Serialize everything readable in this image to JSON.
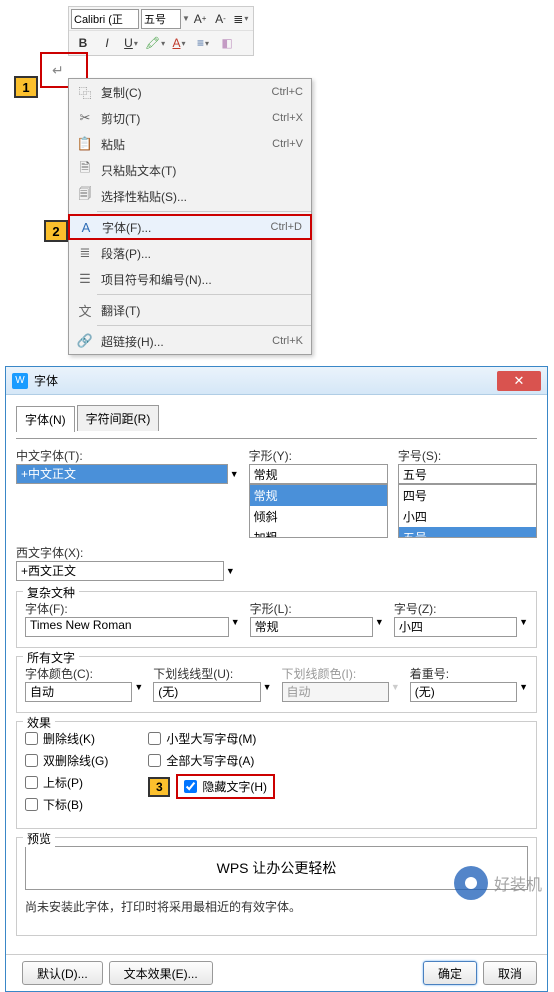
{
  "toolbar": {
    "font_name": "Calibri (正",
    "font_size": "五号"
  },
  "markers": {
    "m1": "1",
    "m2": "2",
    "m3": "3"
  },
  "ctx": {
    "copy": {
      "label": "复制(C)",
      "shortcut": "Ctrl+C"
    },
    "cut": {
      "label": "剪切(T)",
      "shortcut": "Ctrl+X"
    },
    "paste": {
      "label": "粘贴",
      "shortcut": "Ctrl+V"
    },
    "paste_text": {
      "label": "只粘贴文本(T)"
    },
    "paste_special": {
      "label": "选择性粘贴(S)..."
    },
    "font": {
      "label": "字体(F)...",
      "shortcut": "Ctrl+D"
    },
    "paragraph": {
      "label": "段落(P)..."
    },
    "bullets": {
      "label": "项目符号和编号(N)..."
    },
    "translate": {
      "label": "翻译(T)"
    },
    "hyperlink": {
      "label": "超链接(H)...",
      "shortcut": "Ctrl+K"
    }
  },
  "dialog": {
    "title": "字体",
    "tabs": {
      "font": "字体(N)",
      "spacing": "字符间距(R)"
    },
    "labels": {
      "cn_font": "中文字体(T):",
      "style": "字形(Y):",
      "size": "字号(S):",
      "west_font": "西文字体(X):",
      "complex": "复杂文种",
      "complex_font": "字体(F):",
      "complex_style": "字形(L):",
      "complex_size": "字号(Z):",
      "all_text": "所有文字",
      "font_color": "字体颜色(C):",
      "underline_style": "下划线线型(U):",
      "underline_color": "下划线颜色(I):",
      "emphasis": "着重号:",
      "effects": "效果",
      "preview": "预览"
    },
    "values": {
      "cn_font": "+中文正文",
      "style": "常规",
      "size": "五号",
      "west_font": "+西文正文",
      "complex_font": "Times New Roman",
      "complex_style": "常规",
      "complex_size": "小四",
      "auto": "自动",
      "none": "(无)"
    },
    "style_list": [
      "常规",
      "倾斜",
      "加粗"
    ],
    "size_list": [
      "四号",
      "小四",
      "五号"
    ],
    "effects": {
      "strikethrough": "删除线(K)",
      "double_strike": "双删除线(G)",
      "superscript": "上标(P)",
      "subscript": "下标(B)",
      "small_caps": "小型大写字母(M)",
      "all_caps": "全部大写字母(A)",
      "hidden": "隐藏文字(H)"
    },
    "preview_text": "WPS 让办公更轻松",
    "note": "尚未安装此字体，打印时将采用最相近的有效字体。",
    "buttons": {
      "default": "默认(D)...",
      "text_effects": "文本效果(E)...",
      "ok": "确定",
      "cancel": "取消"
    }
  },
  "watermark": "好装机"
}
